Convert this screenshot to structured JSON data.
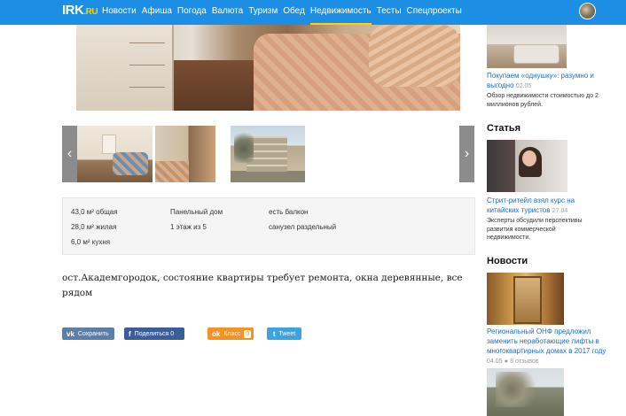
{
  "header": {
    "logo": {
      "name": "IRK",
      "suffix": ".RU"
    },
    "nav": [
      {
        "label": "Новости"
      },
      {
        "label": "Афиша"
      },
      {
        "label": "Погода"
      },
      {
        "label": "Валюта"
      },
      {
        "label": "Туризм"
      },
      {
        "label": "Обед"
      },
      {
        "label": "Недвижимость",
        "active": true
      },
      {
        "label": "Тесты"
      },
      {
        "label": "Спецпроекты"
      }
    ]
  },
  "gallery": {
    "prev_icon": "‹",
    "next_icon": "›"
  },
  "details": {
    "total_area": "43,0 м² общая",
    "living_area": "28,0 м² жилая",
    "kitchen_area": "6,0 м² кухня",
    "building_type": "Панельный дом",
    "floor": "1 этаж из 5",
    "balcony": "есть балкон",
    "bathroom": "санузел раздельный"
  },
  "description": "ост.Академгородок, состояние квартиры требует ремонта, окна деревянные, все рядом",
  "share": {
    "vk": {
      "icon": "vk",
      "label": "Сохранить"
    },
    "fb": {
      "icon": "f",
      "label": "Поделиться",
      "count": "0"
    },
    "ok": {
      "icon": "ok",
      "label": "Класс",
      "count": "0"
    },
    "tw": {
      "icon": "t",
      "label": "Tweet"
    }
  },
  "sidebar": {
    "item1": {
      "title": "Покупаем «однушку»: разумно и выгодно",
      "date": "02.05",
      "text": "Обзор недвижимости стоимостью до 2 миллионов рублей."
    },
    "article_heading": "Статья",
    "item2": {
      "title": "Стрит-ритейл взял курс на китайских туристов",
      "date": "27.04",
      "text": "Эксперты обсудили перспективы развития коммерческой недвижимости."
    },
    "news_heading": "Новости",
    "item3": {
      "title": "Региональный ОНФ предложил заменить неработающие лифты в многоквартирных домах в 2017 году",
      "date": "04.05",
      "reviews": "8 отзывов"
    }
  },
  "colors": {
    "nav_bg": "#1c8ee3",
    "accent_yellow": "#ffd200",
    "link_blue": "#1a6fc7"
  }
}
